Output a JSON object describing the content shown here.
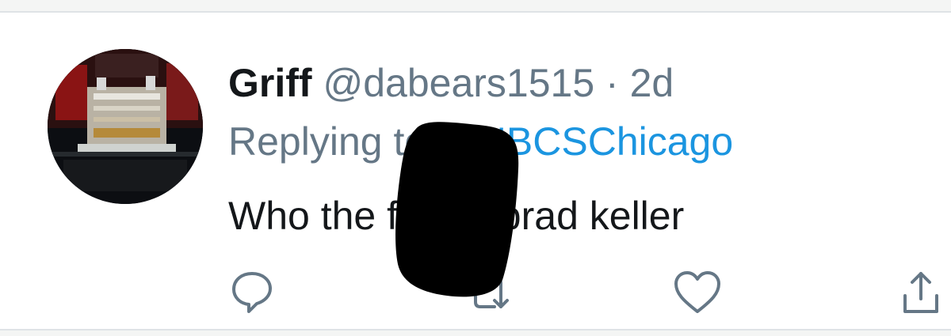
{
  "tweet": {
    "author_name": "Griff",
    "handle": "@dabears1515",
    "separator": "·",
    "time": "2d",
    "reply_prefix": "Replying to ",
    "reply_target": "@NBCSChicago",
    "text": "Who the f**k is brad keller"
  },
  "actions": [
    {
      "name": "reply",
      "icon": "reply-icon"
    },
    {
      "name": "retweet",
      "icon": "retweet-icon"
    },
    {
      "name": "like",
      "icon": "heart-icon"
    },
    {
      "name": "share",
      "icon": "share-icon"
    }
  ],
  "colors": {
    "primary_text": "#14171a",
    "secondary_text": "#657786",
    "link": "#1b95e0",
    "border": "#dfe3e6"
  }
}
